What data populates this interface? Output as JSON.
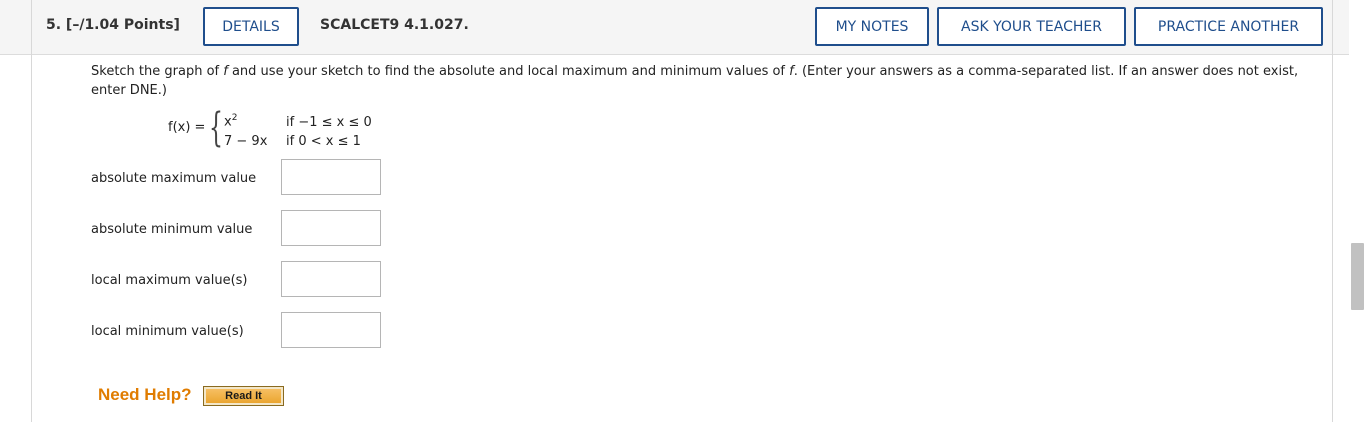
{
  "header": {
    "question_number": "5.  [–/1.04 Points]",
    "details_label": "DETAILS",
    "problem_code": "SCALCET9 4.1.027.",
    "my_notes_label": "MY NOTES",
    "ask_teacher_label": "ASK YOUR TEACHER",
    "practice_another_label": "PRACTICE ANOTHER"
  },
  "prompt": {
    "part1": "Sketch the graph of ",
    "f1": "f",
    "part2": " and use your sketch to find the absolute and local maximum and minimum values of ",
    "f2": "f",
    "part3": ". (Enter your answers as a comma-separated list. If an answer does not exist, enter DNE.)"
  },
  "function": {
    "label": "f(x) =",
    "piece1_expr": "x",
    "piece1_exp": "2",
    "piece1_cond": "if −1 ≤ x ≤ 0",
    "piece2_expr": "7 − 9x",
    "piece2_cond": "if 0 < x ≤ 1"
  },
  "answers": [
    {
      "label": "absolute maximum value",
      "value": ""
    },
    {
      "label": "absolute minimum value",
      "value": ""
    },
    {
      "label": "local maximum value(s)",
      "value": ""
    },
    {
      "label": "local minimum value(s)",
      "value": ""
    }
  ],
  "help": {
    "need_help_label": "Need Help?",
    "read_it_label": "Read It"
  }
}
